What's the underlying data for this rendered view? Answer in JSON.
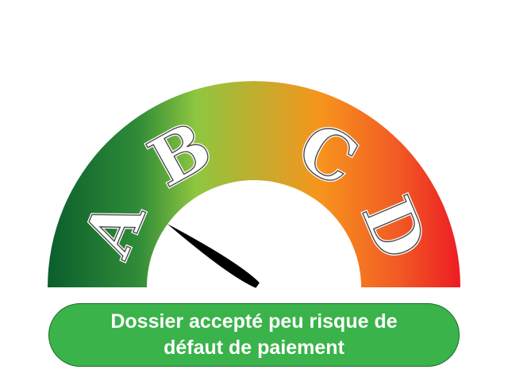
{
  "gauge": {
    "grades": [
      "A",
      "B",
      "C",
      "D"
    ],
    "needle_fraction": 0.19,
    "gradient_colors": [
      "#0a5e2c",
      "#2f8c38",
      "#8ec63f",
      "#f7941d",
      "#f15a24",
      "#ed1c24"
    ],
    "letter_ink": "#4a4a4a"
  },
  "status": {
    "text": "Dossier accepté peu risque de\ndéfaut de paiement",
    "color": "#3ab34a"
  }
}
